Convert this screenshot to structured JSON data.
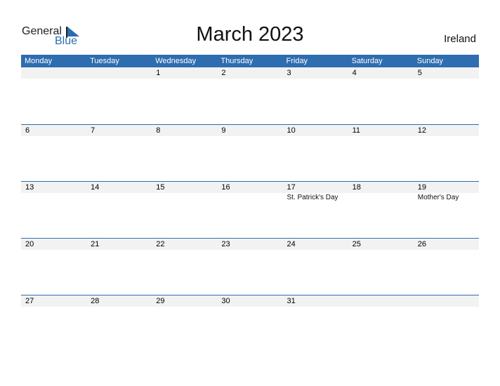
{
  "logo": {
    "word1": "General",
    "word2": "Blue",
    "icon": "triangle-flag-icon"
  },
  "title": "March 2023",
  "country": "Ireland",
  "weekdays": [
    "Monday",
    "Tuesday",
    "Wednesday",
    "Thursday",
    "Friday",
    "Saturday",
    "Sunday"
  ],
  "weeks": [
    {
      "days": [
        "",
        "",
        "1",
        "2",
        "3",
        "4",
        "5"
      ],
      "holidays": [
        "",
        "",
        "",
        "",
        "",
        "",
        ""
      ]
    },
    {
      "days": [
        "6",
        "7",
        "8",
        "9",
        "10",
        "11",
        "12"
      ],
      "holidays": [
        "",
        "",
        "",
        "",
        "",
        "",
        ""
      ]
    },
    {
      "days": [
        "13",
        "14",
        "15",
        "16",
        "17",
        "18",
        "19"
      ],
      "holidays": [
        "",
        "",
        "",
        "",
        "St. Patrick's Day",
        "",
        "Mother's Day"
      ]
    },
    {
      "days": [
        "20",
        "21",
        "22",
        "23",
        "24",
        "25",
        "26"
      ],
      "holidays": [
        "",
        "",
        "",
        "",
        "",
        "",
        ""
      ]
    },
    {
      "days": [
        "27",
        "28",
        "29",
        "30",
        "31",
        "",
        ""
      ],
      "holidays": [
        "",
        "",
        "",
        "",
        "",
        "",
        ""
      ]
    }
  ],
  "colors": {
    "accent": "#2e6daf",
    "strip": "#f2f2f2"
  }
}
